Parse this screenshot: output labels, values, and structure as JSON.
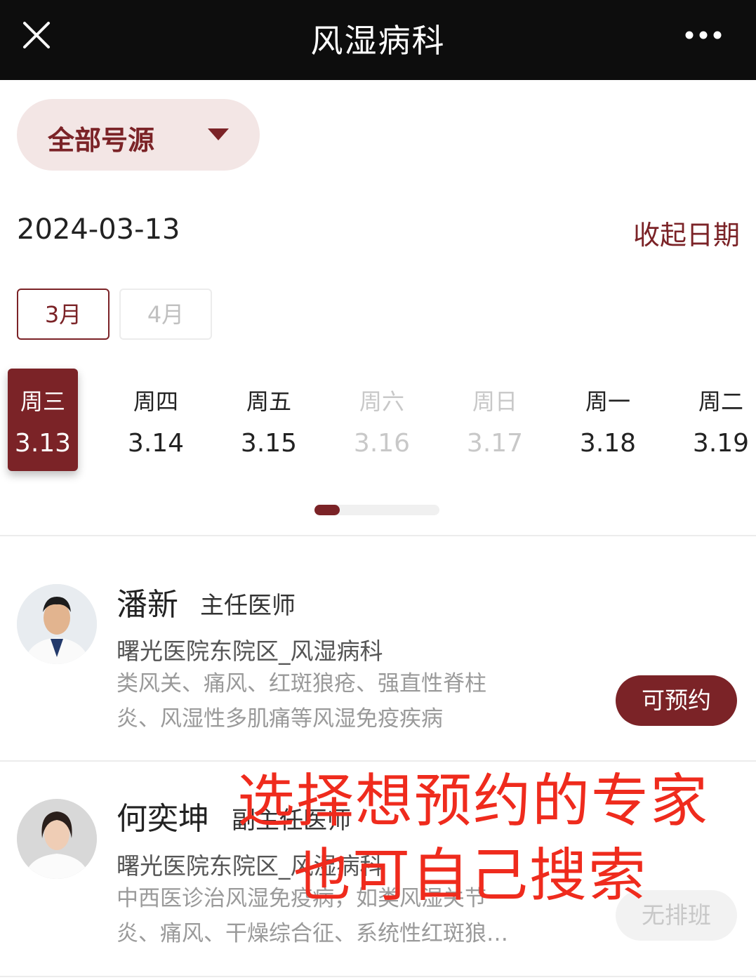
{
  "header": {
    "title": "风湿病科"
  },
  "filter": {
    "label": "全部号源"
  },
  "date_bar": {
    "selected_date": "2024-03-13",
    "collapse_label": "收起日期"
  },
  "months": [
    {
      "label": "3月",
      "state": "active"
    },
    {
      "label": "4月",
      "state": "inactive"
    }
  ],
  "days": [
    {
      "weekday": "周三",
      "date": "3.13",
      "state": "selected"
    },
    {
      "weekday": "周四",
      "date": "3.14",
      "state": "normal"
    },
    {
      "weekday": "周五",
      "date": "3.15",
      "state": "normal"
    },
    {
      "weekday": "周六",
      "date": "3.16",
      "state": "disabled"
    },
    {
      "weekday": "周日",
      "date": "3.17",
      "state": "disabled"
    },
    {
      "weekday": "周一",
      "date": "3.18",
      "state": "normal"
    },
    {
      "weekday": "周二",
      "date": "3.19",
      "state": "normal"
    }
  ],
  "doctors": [
    {
      "name": "潘新",
      "title": "主任医师",
      "hospital": "曙光医院东院区_风湿病科",
      "description": "类风关、痛风、红斑狼疮、强直性脊柱炎、风湿性多肌痛等风湿免疫疾病",
      "button": "可预约",
      "status": "available"
    },
    {
      "name": "何奕坤",
      "title": "副主任医师",
      "hospital": "曙光医院东院区_风湿病科",
      "description": "中西医诊治风湿免疫病，如类风湿关节炎、痛风、干燥综合征、系统性红斑狼…",
      "button": "无排班",
      "status": "none"
    }
  ],
  "annotation": {
    "line1": "选择想预约的专家",
    "line2": "也可自己搜索"
  },
  "colors": {
    "brand": "#7b2327",
    "topbar": "#0d0d0d",
    "annotation": "#ef2b1d"
  }
}
